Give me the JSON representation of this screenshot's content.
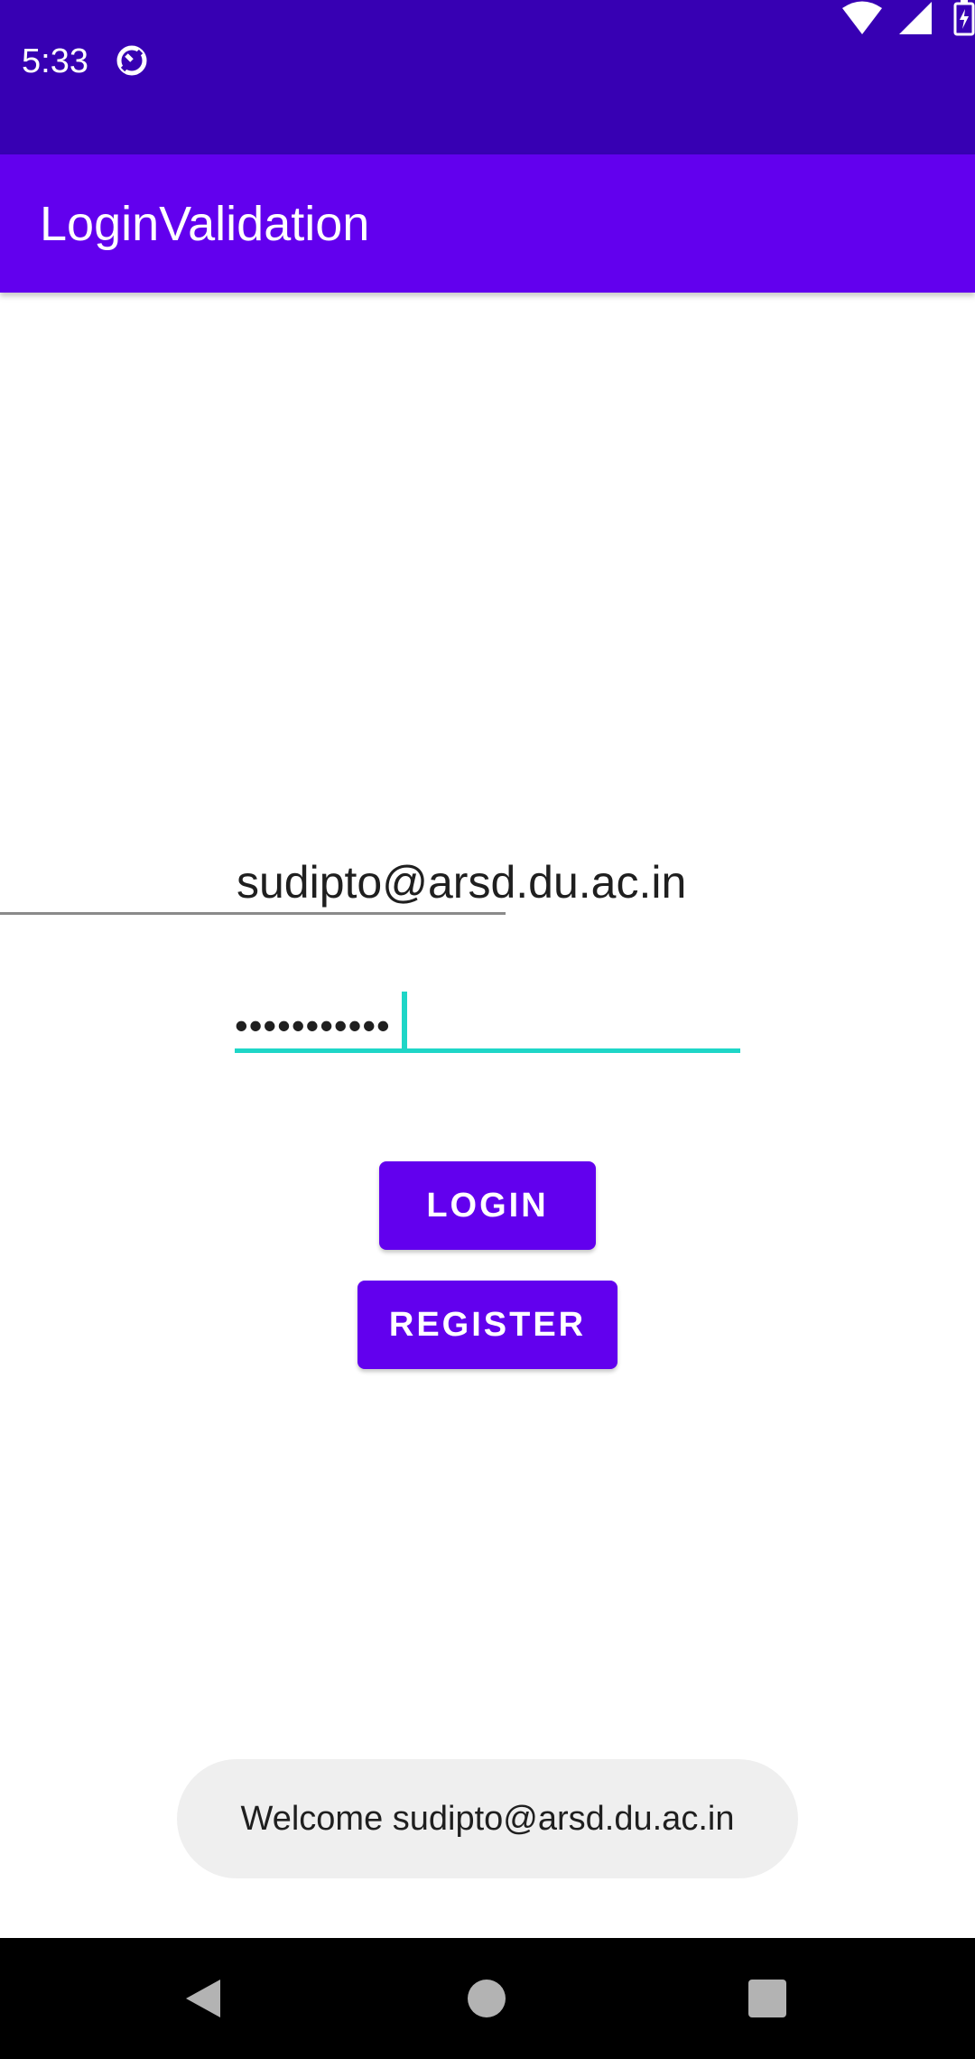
{
  "status_bar": {
    "time": "5:33",
    "background": "#3700b3",
    "icons": [
      "sync-icon",
      "wifi-icon",
      "signal-icon",
      "battery-charging-icon"
    ]
  },
  "app_bar": {
    "title": "LoginValidation",
    "background": "#6200ee"
  },
  "form": {
    "email_value": "sudipto@arsd.du.ac.in",
    "password_mask": "•••••••••••",
    "accent_color": "#1ed6c7"
  },
  "buttons": {
    "login_label": "LOGIN",
    "register_label": "REGISTER",
    "color": "#6200ee"
  },
  "toast": {
    "message": "Welcome sudipto@arsd.du.ac.in"
  },
  "nav_bar": {
    "icons": [
      "back-icon",
      "home-icon",
      "recents-icon"
    ]
  }
}
